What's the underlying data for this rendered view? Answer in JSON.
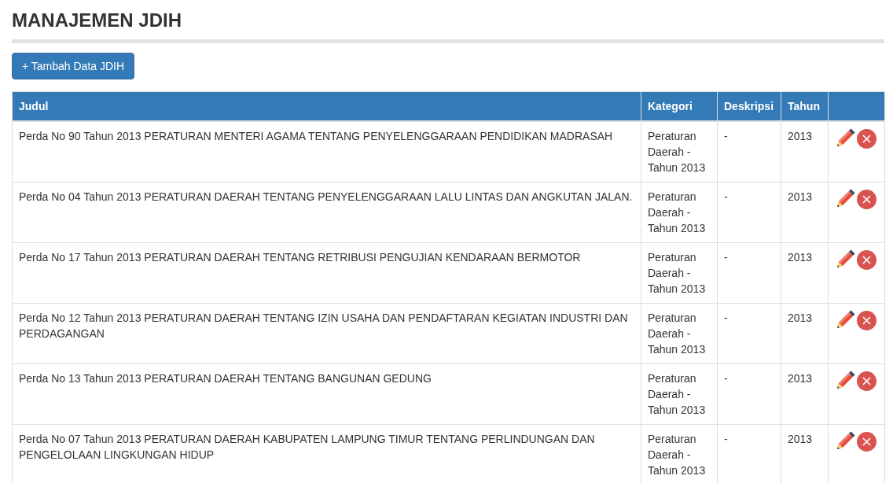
{
  "page_title": "MANAJEMEN JDIH",
  "add_button": "+ Tambah Data JDIH",
  "table": {
    "columns": [
      "Judul",
      "Kategori",
      "Deskripsi",
      "Tahun"
    ],
    "rows": [
      {
        "judul": "Perda No 90 Tahun 2013 PERATURAN MENTERI AGAMA TENTANG PENYELENGGARAAN PENDIDIKAN MADRASAH",
        "kategori": "Peraturan Daerah - Tahun 2013",
        "deskripsi": "-",
        "tahun": "2013"
      },
      {
        "judul": "Perda No 04 Tahun 2013 PERATURAN DAERAH TENTANG PENYELENGGARAAN LALU LINTAS DAN ANGKUTAN JALAN.",
        "kategori": "Peraturan Daerah - Tahun 2013",
        "deskripsi": "-",
        "tahun": "2013"
      },
      {
        "judul": "Perda No 17 Tahun 2013 PERATURAN DAERAH TENTANG RETRIBUSI PENGUJIAN KENDARAAN BERMOTOR",
        "kategori": "Peraturan Daerah - Tahun 2013",
        "deskripsi": "-",
        "tahun": "2013"
      },
      {
        "judul": "Perda No 12 Tahun 2013 PERATURAN DAERAH TENTANG IZIN USAHA DAN PENDAFTARAN KEGIATAN INDUSTRI DAN PERDAGANGAN",
        "kategori": "Peraturan Daerah - Tahun 2013",
        "deskripsi": "-",
        "tahun": "2013"
      },
      {
        "judul": "Perda No 13 Tahun 2013 PERATURAN DAERAH TENTANG BANGUNAN GEDUNG",
        "kategori": "Peraturan Daerah - Tahun 2013",
        "deskripsi": "-",
        "tahun": "2013"
      },
      {
        "judul": "Perda No 07 Tahun 2013 PERATURAN DAERAH KABUPATEN LAMPUNG TIMUR TENTANG PERLINDUNGAN DAN PENGELOLAAN LINGKUNGAN HIDUP",
        "kategori": "Peraturan Daerah - Tahun 2013",
        "deskripsi": "-",
        "tahun": "2013"
      }
    ]
  }
}
